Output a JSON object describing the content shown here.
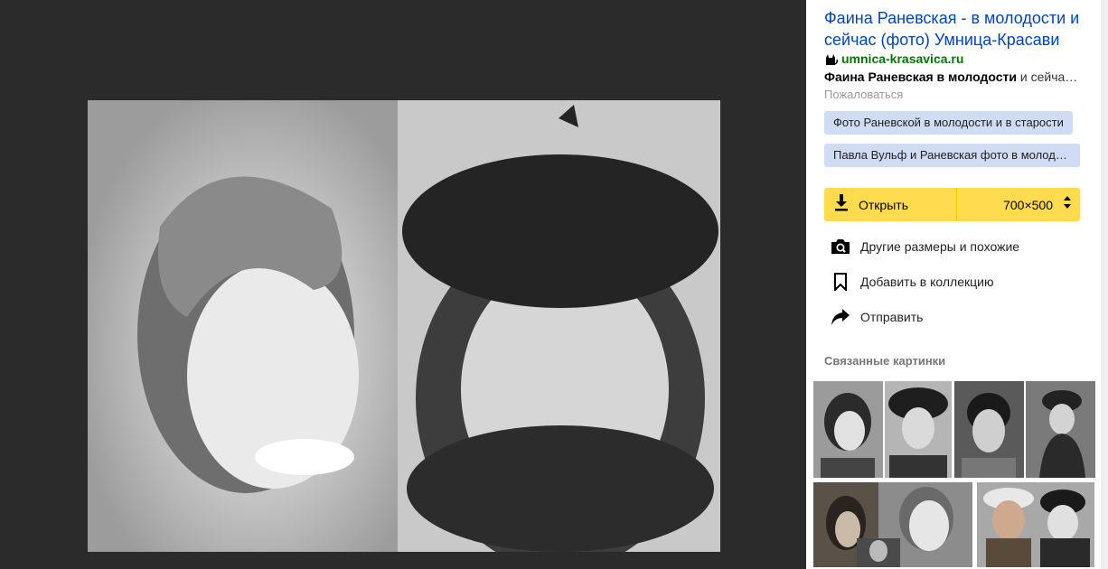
{
  "panel": {
    "title": "Фаина Раневская - в молодости и сейчас (фото) Умница-Красави",
    "site_domain": "umnica-krasavica.ru",
    "snippet_bold": "Фаина Раневская в молодости",
    "snippet_rest": " и сейча…",
    "complain": "Пожаловаться",
    "tags": [
      "Фото Раневской в молодости и в старости",
      "Павла Вульф и Раневская фото в молод…"
    ],
    "open_label": "Открыть",
    "size_label": "700×500",
    "actions": [
      "Другие размеры и похожие",
      "Добавить в коллекцию",
      "Отправить"
    ],
    "related_title": "Связанные картинки"
  },
  "colors": {
    "viewer_bg": "#2b2b2b",
    "title_link": "#0044bb",
    "domain_green": "#007700",
    "tag_bg": "#cfdcf3",
    "open_yellow": "#ffdb4d"
  },
  "icons": {
    "site": "cat-icon",
    "open": "download-icon",
    "size": "up-down-arrows-icon",
    "similar": "camera-search-icon",
    "collection": "bookmark-icon",
    "share": "share-arrow-icon"
  }
}
